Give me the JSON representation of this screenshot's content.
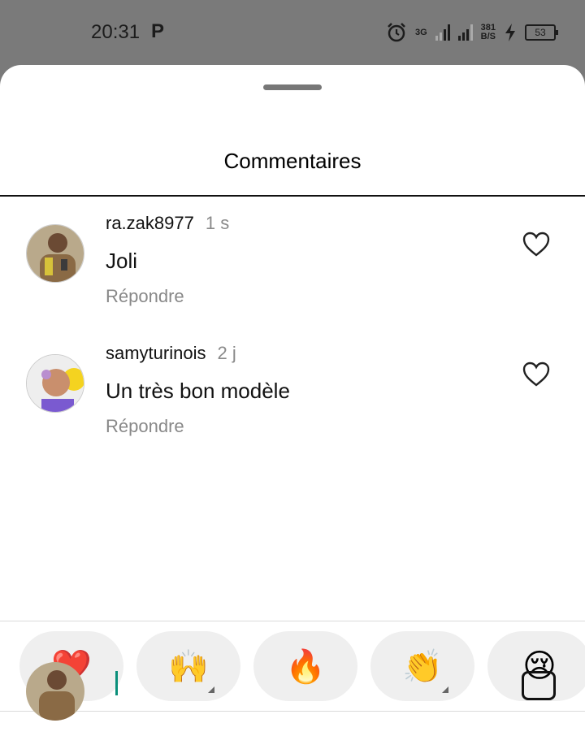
{
  "status_bar": {
    "time": "20:31",
    "network_type": "3G",
    "speed_value": "381",
    "speed_unit": "B/S",
    "battery": "53",
    "icons": [
      "p-notification-icon",
      "alarm-icon",
      "signal-icon",
      "charging-icon",
      "battery-icon"
    ]
  },
  "sheet": {
    "title": "Commentaires"
  },
  "comments": [
    {
      "username": "ra.zak8977",
      "time": "1 s",
      "text": "Joli",
      "reply_label": "Répondre"
    },
    {
      "username": "samyturinois",
      "time": "2 j",
      "text": "Un très bon modèle",
      "reply_label": "Répondre"
    }
  ],
  "quick_reactions": [
    {
      "emoji": "❤️",
      "name": "heart"
    },
    {
      "emoji": "🙌",
      "name": "raising-hands"
    },
    {
      "emoji": "🔥",
      "name": "fire"
    },
    {
      "emoji": "👏",
      "name": "clapping-hands"
    },
    {
      "emoji": "😢",
      "name": "crying-face"
    }
  ],
  "colors": {
    "accent_cursor": "#0a8f7a",
    "muted_text": "#888888"
  }
}
